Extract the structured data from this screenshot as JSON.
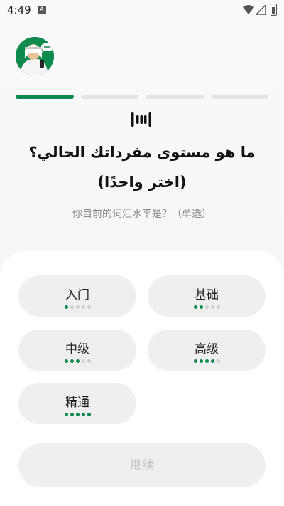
{
  "status_bar": {
    "time": "4:49",
    "notification_glyph": "A"
  },
  "question": {
    "arabic": "ما هو مستوى مفرداتك الحالي؟ (اختر واحدًا)",
    "chinese": "你目前的词汇水平是？（单选）"
  },
  "progress": {
    "total_steps": 4,
    "current_step": 1
  },
  "options": [
    {
      "label": "入门",
      "level": 1
    },
    {
      "label": "基础",
      "level": 2
    },
    {
      "label": "中级",
      "level": 3
    },
    {
      "label": "高级",
      "level": 4
    },
    {
      "label": "精通",
      "level": 5
    }
  ],
  "continue_label": "继续",
  "colors": {
    "accent": "#0f8a4f",
    "dot_inactive": "#cfcfcf",
    "button_bg": "#efefef"
  }
}
